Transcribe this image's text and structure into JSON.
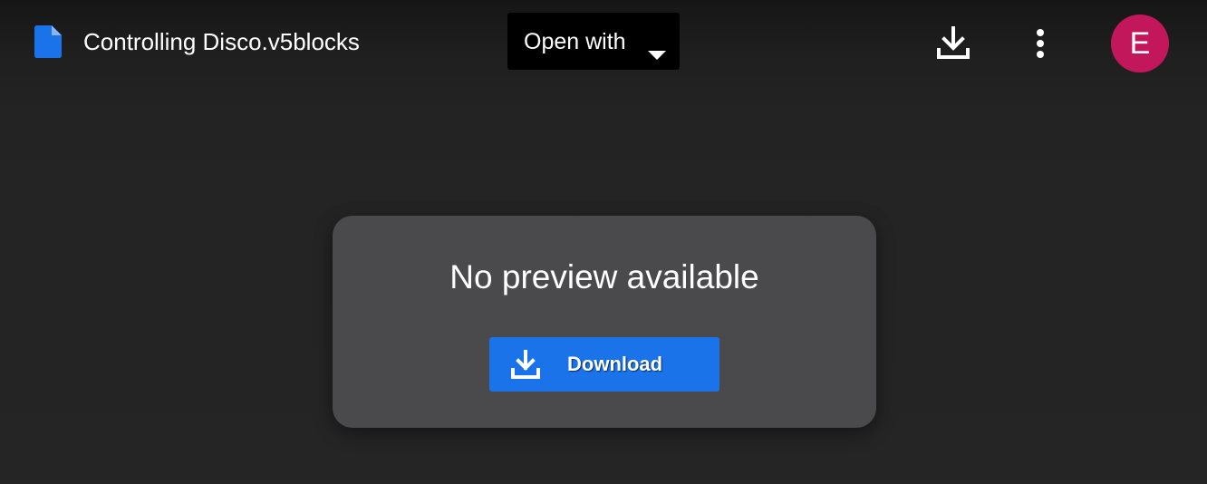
{
  "header": {
    "file_icon": "file-document-icon",
    "file_title": "Controlling Disco.v5blocks",
    "open_with_label": "Open with",
    "download_icon": "download-icon",
    "more_icon": "more-vertical-icon",
    "avatar_initial": "E"
  },
  "preview": {
    "message": "No preview available",
    "download_label": "Download",
    "download_icon": "download-icon"
  },
  "colors": {
    "accent": "#1a73e8",
    "avatar": "#c2185b",
    "card": "#4a494c",
    "background": "#232323"
  }
}
